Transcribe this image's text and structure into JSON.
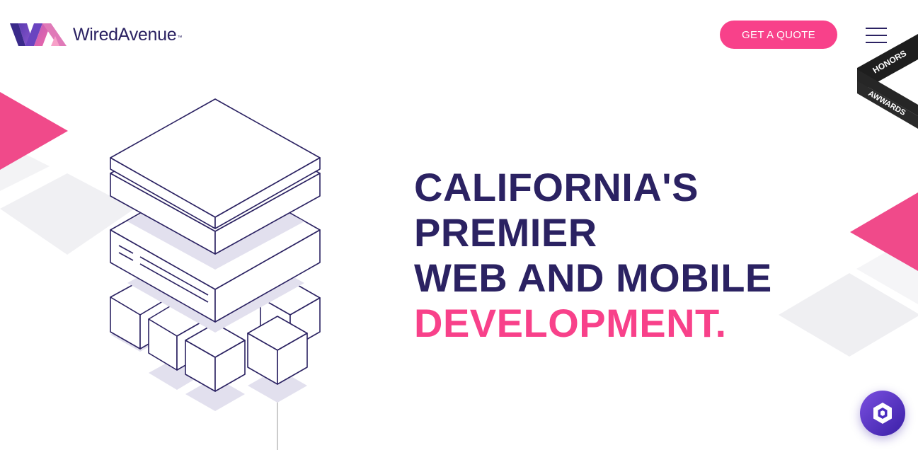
{
  "header": {
    "logo_text": "WiredAvenue",
    "logo_tm": "™",
    "quote_button": "GET A QUOTE",
    "menu_icon": "hamburger-menu-icon"
  },
  "ribbon": {
    "line1": "HONORS",
    "line2": "AWWARDS"
  },
  "hero": {
    "line1": "CALIFORNIA'S",
    "line2": "PREMIER",
    "line3": "WEB AND MOBILE",
    "line4": "DEVELOPMENT."
  },
  "chat": {
    "icon": "chat-widget-icon"
  },
  "colors": {
    "brand": "#2b2262",
    "accent": "#f8418a",
    "shape_gray": "#f2f2f4"
  }
}
